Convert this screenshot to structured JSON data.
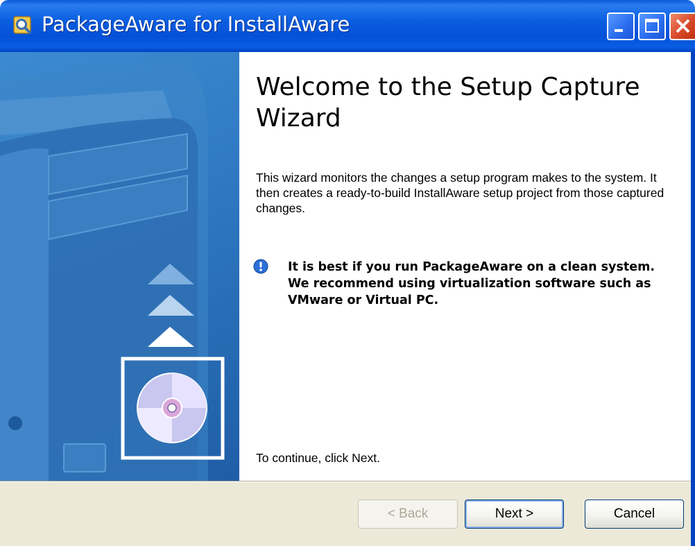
{
  "window": {
    "title": "PackageAware for InstallAware",
    "colors": {
      "titlebar": "#0451d8",
      "banner": "#2d77c0",
      "close": "#d8492a",
      "footer": "#ece9d8"
    }
  },
  "titlebar_buttons": {
    "minimize_icon": "minimize-icon",
    "maximize_icon": "maximize-icon",
    "close_icon": "close-icon"
  },
  "content": {
    "heading": "Welcome to the Setup Capture Wizard",
    "description": "This wizard monitors the changes a setup program makes to the system. It then creates a ready-to-build InstallAware setup project from those captured changes.",
    "tip": "It is best if you run PackageAware on a clean system. We recommend using virtualization software such as VMware or Virtual PC.",
    "continue": "To continue, click Next."
  },
  "buttons": {
    "back": "< Back",
    "next": "Next >",
    "cancel": "Cancel"
  }
}
